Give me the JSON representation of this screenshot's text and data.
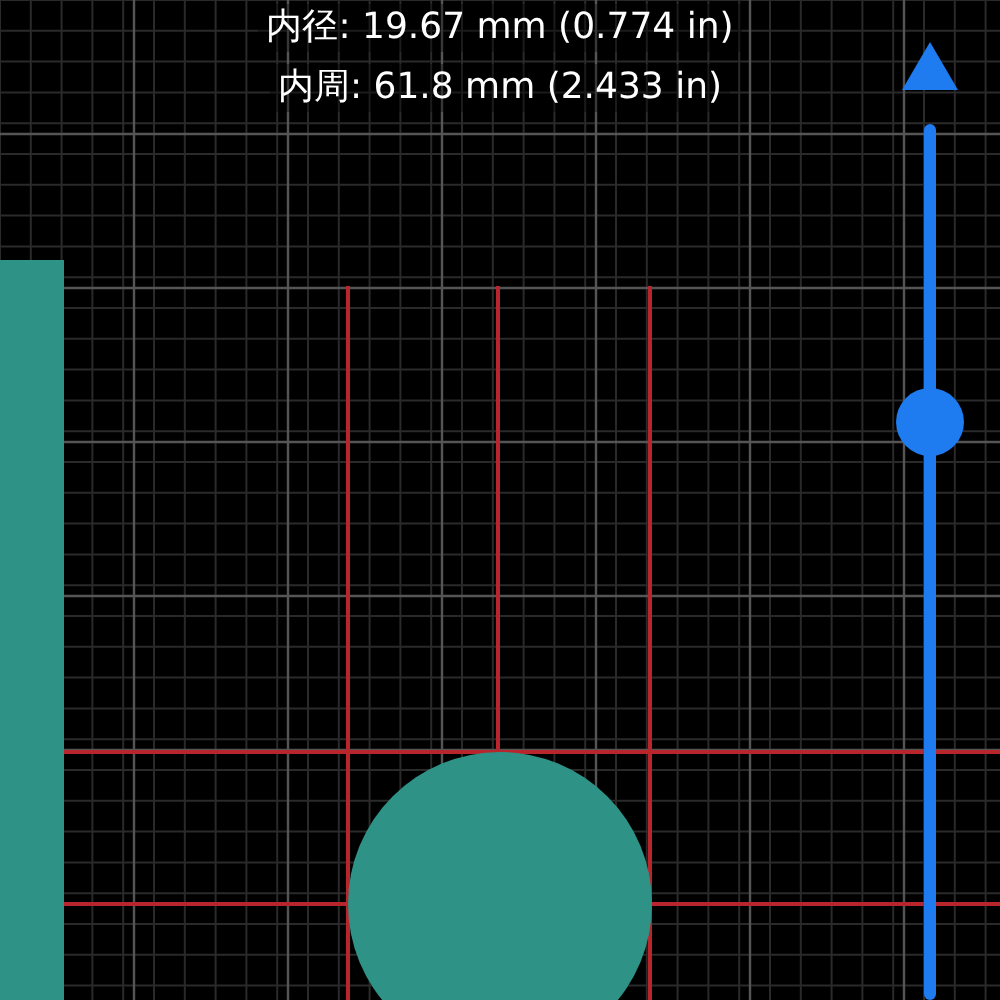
{
  "measurements": [
    {
      "label": "内径: 19.67 mm (0.774 in)"
    },
    {
      "label": "内周: 61.8 mm (2.433 in)"
    }
  ],
  "size_slider": {
    "level": 0.66
  }
}
